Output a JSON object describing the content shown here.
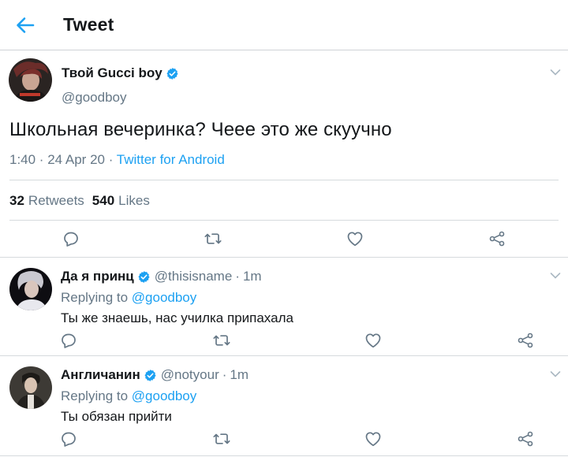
{
  "header": {
    "title": "Tweet",
    "back_icon": "arrow-left-icon",
    "accent": "#1da1f2"
  },
  "tweet": {
    "author_name": "Твой Gucci boy",
    "author_handle": "@goodboy",
    "text": "Школьная вечеринка? Чеее это же скуучно",
    "time": "1:40 · 24 Apr 20 · ",
    "source": "Twitter for Android",
    "retweets_count": "32",
    "retweets_label": "Retweets",
    "likes_count": "540",
    "likes_label": "Likes"
  },
  "replies": [
    {
      "name": "Да я принц",
      "handle": "@thisisname",
      "time": "1m",
      "replying_label": "Replying to ",
      "replying_to": "@goodboy",
      "text": "Ты же знаешь, нас училка припахала"
    },
    {
      "name": "Англичанин",
      "handle": "@notyour",
      "time": "1m",
      "replying_label": "Replying to ",
      "replying_to": "@goodboy",
      "text": "Ты обязан прийти"
    }
  ],
  "separator": "·",
  "colors": {
    "text": "#14171a",
    "muted": "#657786",
    "link": "#1da1f2",
    "verified": "#1da1f2",
    "border": "#d6dadd"
  }
}
